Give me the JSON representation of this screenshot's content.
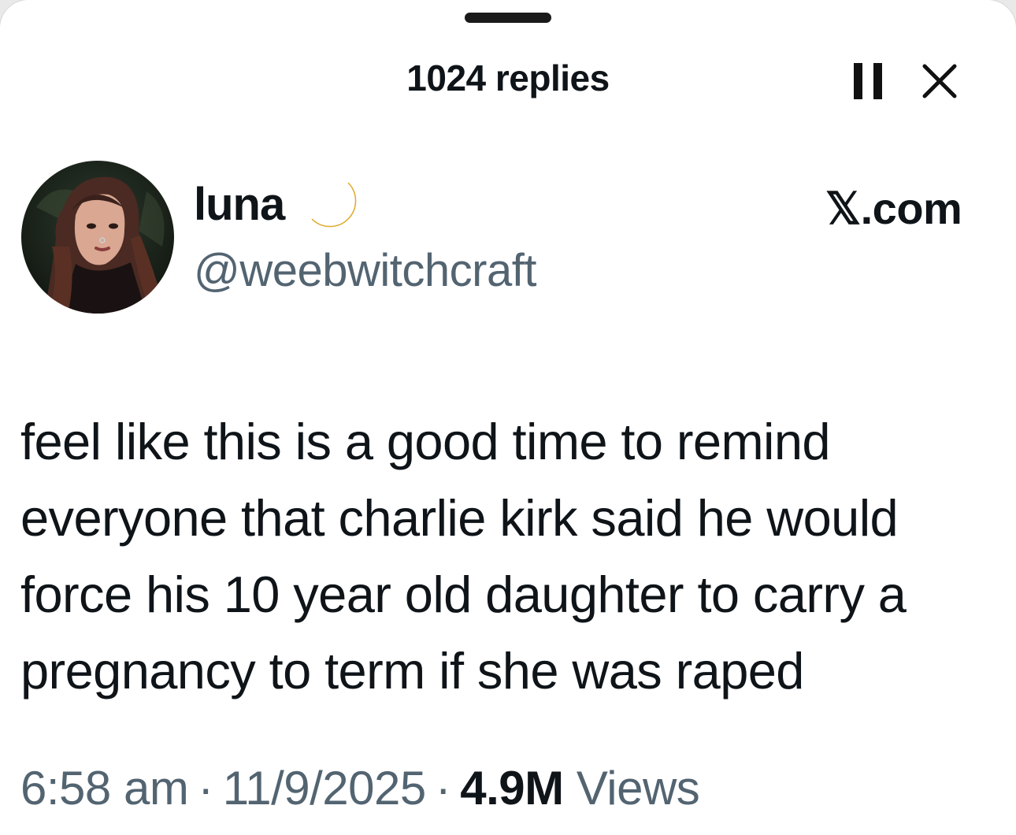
{
  "sheet": {
    "title": "1024 replies",
    "pause_icon": "pause-icon",
    "close_icon": "close-icon"
  },
  "tweet": {
    "author": {
      "display_name": "luna",
      "emoji": "crescent-moon",
      "handle": "@weebwitchcraft"
    },
    "source": "𝕏.com",
    "text": "feel like this is a good time to remind everyone that charlie kirk said he would force his 10 year old daughter to carry a pregnancy to term if she was raped",
    "time": "6:58 am",
    "date": "11/9/2025",
    "views_count": "4.9M",
    "views_label": "Views",
    "separator": "·"
  },
  "colors": {
    "text_primary": "#0f1419",
    "text_secondary": "#536471",
    "moon": "#f7c948"
  }
}
